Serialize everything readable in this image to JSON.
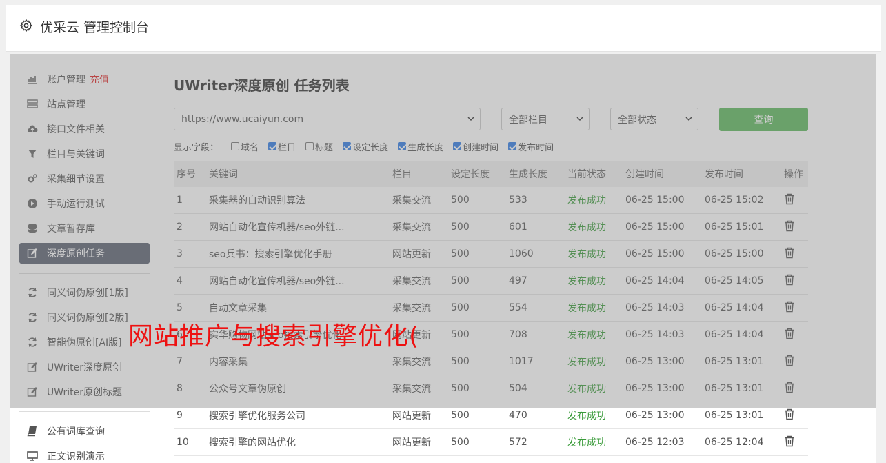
{
  "header": {
    "title": "优采云 管理控制台",
    "icon": "gear-icon"
  },
  "sidebar": {
    "items": [
      {
        "label": "账户管理",
        "badge": "充值",
        "icon": "bar-chart-icon"
      },
      {
        "label": "站点管理",
        "icon": "server-icon"
      },
      {
        "label": "接口文件相关",
        "icon": "cloud-upload-icon"
      },
      {
        "label": "栏目与关键词",
        "icon": "filter-icon"
      },
      {
        "label": "采集细节设置",
        "icon": "cogs-icon"
      },
      {
        "label": "手动运行测试",
        "icon": "play-circle-icon"
      },
      {
        "label": "文章暂存库",
        "icon": "database-icon"
      },
      {
        "label": "深度原创任务",
        "icon": "edit-icon"
      },
      {
        "label": "同义词伪原创[1版]",
        "icon": "refresh-icon"
      },
      {
        "label": "同义词伪原创[2版]",
        "icon": "refresh-icon"
      },
      {
        "label": "智能伪原创[AI版]",
        "icon": "refresh-icon"
      },
      {
        "label": "UWriter深度原创",
        "icon": "edit-icon"
      },
      {
        "label": "UWriter原创标题",
        "icon": "edit-icon"
      },
      {
        "label": "公有词库查询",
        "icon": "book-icon"
      },
      {
        "label": "正文识别演示",
        "icon": "monitor-icon"
      }
    ]
  },
  "main": {
    "title": "UWriter深度原创 任务列表",
    "site_select": "https://www.ucaiyun.com",
    "column_select": "全部栏目",
    "status_select": "全部状态",
    "query_button": "查询",
    "fields_label": "显示字段：",
    "fields": [
      {
        "label": "域名",
        "checked": false
      },
      {
        "label": "栏目",
        "checked": true
      },
      {
        "label": "标题",
        "checked": false
      },
      {
        "label": "设定长度",
        "checked": true
      },
      {
        "label": "生成长度",
        "checked": true
      },
      {
        "label": "创建时间",
        "checked": true
      },
      {
        "label": "发布时间",
        "checked": true
      }
    ],
    "table": {
      "headers": [
        "序号",
        "关键词",
        "栏目",
        "设定长度",
        "生成长度",
        "当前状态",
        "创建时间",
        "发布时间",
        "操作"
      ],
      "rows": [
        [
          "1",
          "采集器的自动识别算法",
          "采集交流",
          "500",
          "533",
          "发布成功",
          "06-25 15:00",
          "06-25 15:02"
        ],
        [
          "2",
          "网站自动化宣传机器/seo外链...",
          "采集交流",
          "500",
          "601",
          "发布成功",
          "06-25 15:00",
          "06-25 15:01"
        ],
        [
          "3",
          "seo兵书：搜索引擎优化手册",
          "网站更新",
          "500",
          "1060",
          "发布成功",
          "06-25 15:00",
          "06-25 15:00"
        ],
        [
          "4",
          "网站自动化宣传机器/seo外链...",
          "采集交流",
          "500",
          "497",
          "发布成功",
          "06-25 14:04",
          "06-25 14:05"
        ],
        [
          "5",
          "自动文章采集",
          "采集交流",
          "500",
          "554",
          "发布成功",
          "06-25 14:03",
          "06-25 14:04"
        ],
        [
          "6",
          "实华购物网站seo搜索引擎优化",
          "网站更新",
          "500",
          "708",
          "发布成功",
          "06-25 14:03",
          "06-25 14:04"
        ],
        [
          "7",
          "内容采集",
          "采集交流",
          "500",
          "1017",
          "发布成功",
          "06-25 13:00",
          "06-25 13:01"
        ],
        [
          "8",
          "公众号文章伪原创",
          "采集交流",
          "500",
          "504",
          "发布成功",
          "06-25 13:00",
          "06-25 13:01"
        ],
        [
          "9",
          "搜索引擎优化服务公司",
          "网站更新",
          "500",
          "470",
          "发布成功",
          "06-25 13:00",
          "06-25 13:01"
        ],
        [
          "10",
          "搜索引擎的网站优化",
          "网站更新",
          "500",
          "572",
          "发布成功",
          "06-25 12:03",
          "06-25 12:04"
        ]
      ]
    }
  },
  "watermark": "网站推广与搜索引擎优化(",
  "colors": {
    "accent_green": "#5cb85c",
    "status_ok": "#3a9b3a",
    "active_nav": "#5b6171",
    "badge_red": "#e02020"
  }
}
